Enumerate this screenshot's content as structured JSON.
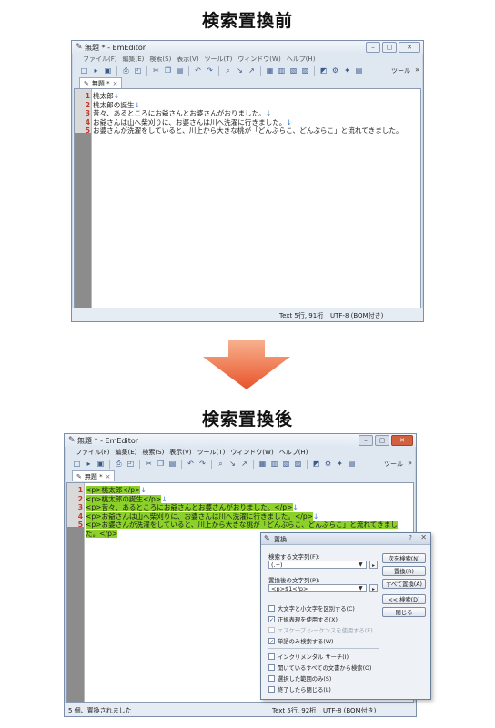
{
  "headings": {
    "before": "検索置換前",
    "after": "検索置換後"
  },
  "app": {
    "title": "無題 * - EmEditor",
    "menu": [
      "ファイル(F)",
      "編集(E)",
      "検索(S)",
      "表示(V)",
      "ツール(T)",
      "ウィンドウ(W)",
      "ヘルプ(H)"
    ],
    "tools_label": "ツール",
    "tab_label": "無題 *"
  },
  "before": {
    "lines": [
      {
        "num": "1",
        "text": "桃太郎"
      },
      {
        "num": "2",
        "text": "桃太郎の誕生"
      },
      {
        "num": "3",
        "text": "昔々、あるところにお爺さんとお婆さんがおりました。"
      },
      {
        "num": "4",
        "text": "お爺さんは山へ柴刈りに、お婆さんは川へ洗濯に行きました。"
      },
      {
        "num": "5",
        "text": "お婆さんが洗濯をしていると、川上から大きな桃が「どんぶらこ、どんぶらこ」と流れてきました。"
      }
    ],
    "status": {
      "left": "",
      "position": "Text  5行, 91桁",
      "encoding": "UTF-8 (BOM付き)"
    }
  },
  "after": {
    "lines": [
      {
        "num": "1",
        "text": "<p>桃太郎</p>"
      },
      {
        "num": "2",
        "text": "<p>桃太郎の誕生</p>"
      },
      {
        "num": "3",
        "text": "<p>昔々、あるところにお爺さんとお婆さんがおりました。</p>"
      },
      {
        "num": "4",
        "text": "<p>お爺さんは山へ柴刈りに、お婆さんは川へ洗濯に行きました。</p>"
      },
      {
        "num": "5",
        "text": "<p>お婆さんが洗濯をしていると、川上から大きな桃が「どんぶらこ、どんぶらこ」と流れてきました。</p>"
      }
    ],
    "status": {
      "left": "5 個、置換されました",
      "position": "Text  5行, 92桁",
      "encoding": "UTF-8 (BOM付き)"
    }
  },
  "dialog": {
    "title": "置換",
    "help": "?",
    "find_label": "検索する文字列(F):",
    "find_value": "(.+)",
    "replace_label": "置換後の文字列(P):",
    "replace_value": "<p>$1</p>",
    "buttons": [
      "次を検索(N)",
      "置換(R)",
      "すべて置換(A)",
      "<< 検索(D)",
      "閉じる"
    ],
    "options": [
      {
        "label": "大文字と小文字を区別する(C)",
        "checked": false,
        "enabled": true
      },
      {
        "label": "正規表現を使用する(X)",
        "checked": true,
        "enabled": true
      },
      {
        "label": "エスケープ シーケンスを使用する(E)",
        "checked": false,
        "enabled": false
      },
      {
        "label": "単語のみ検索する(W)",
        "checked": true,
        "enabled": true
      },
      {
        "label": "インクリメンタル サーチ(I)",
        "checked": false,
        "enabled": true
      },
      {
        "label": "開いているすべての文書から検索(O)",
        "checked": false,
        "enabled": true
      },
      {
        "label": "選択した範囲のみ(S)",
        "checked": false,
        "enabled": true
      },
      {
        "label": "終了したら閉じる(L)",
        "checked": false,
        "enabled": true
      }
    ]
  },
  "colors": {
    "highlight": "#8bd12a",
    "arrow": "#e8532a",
    "line_number": "#c0392b"
  }
}
